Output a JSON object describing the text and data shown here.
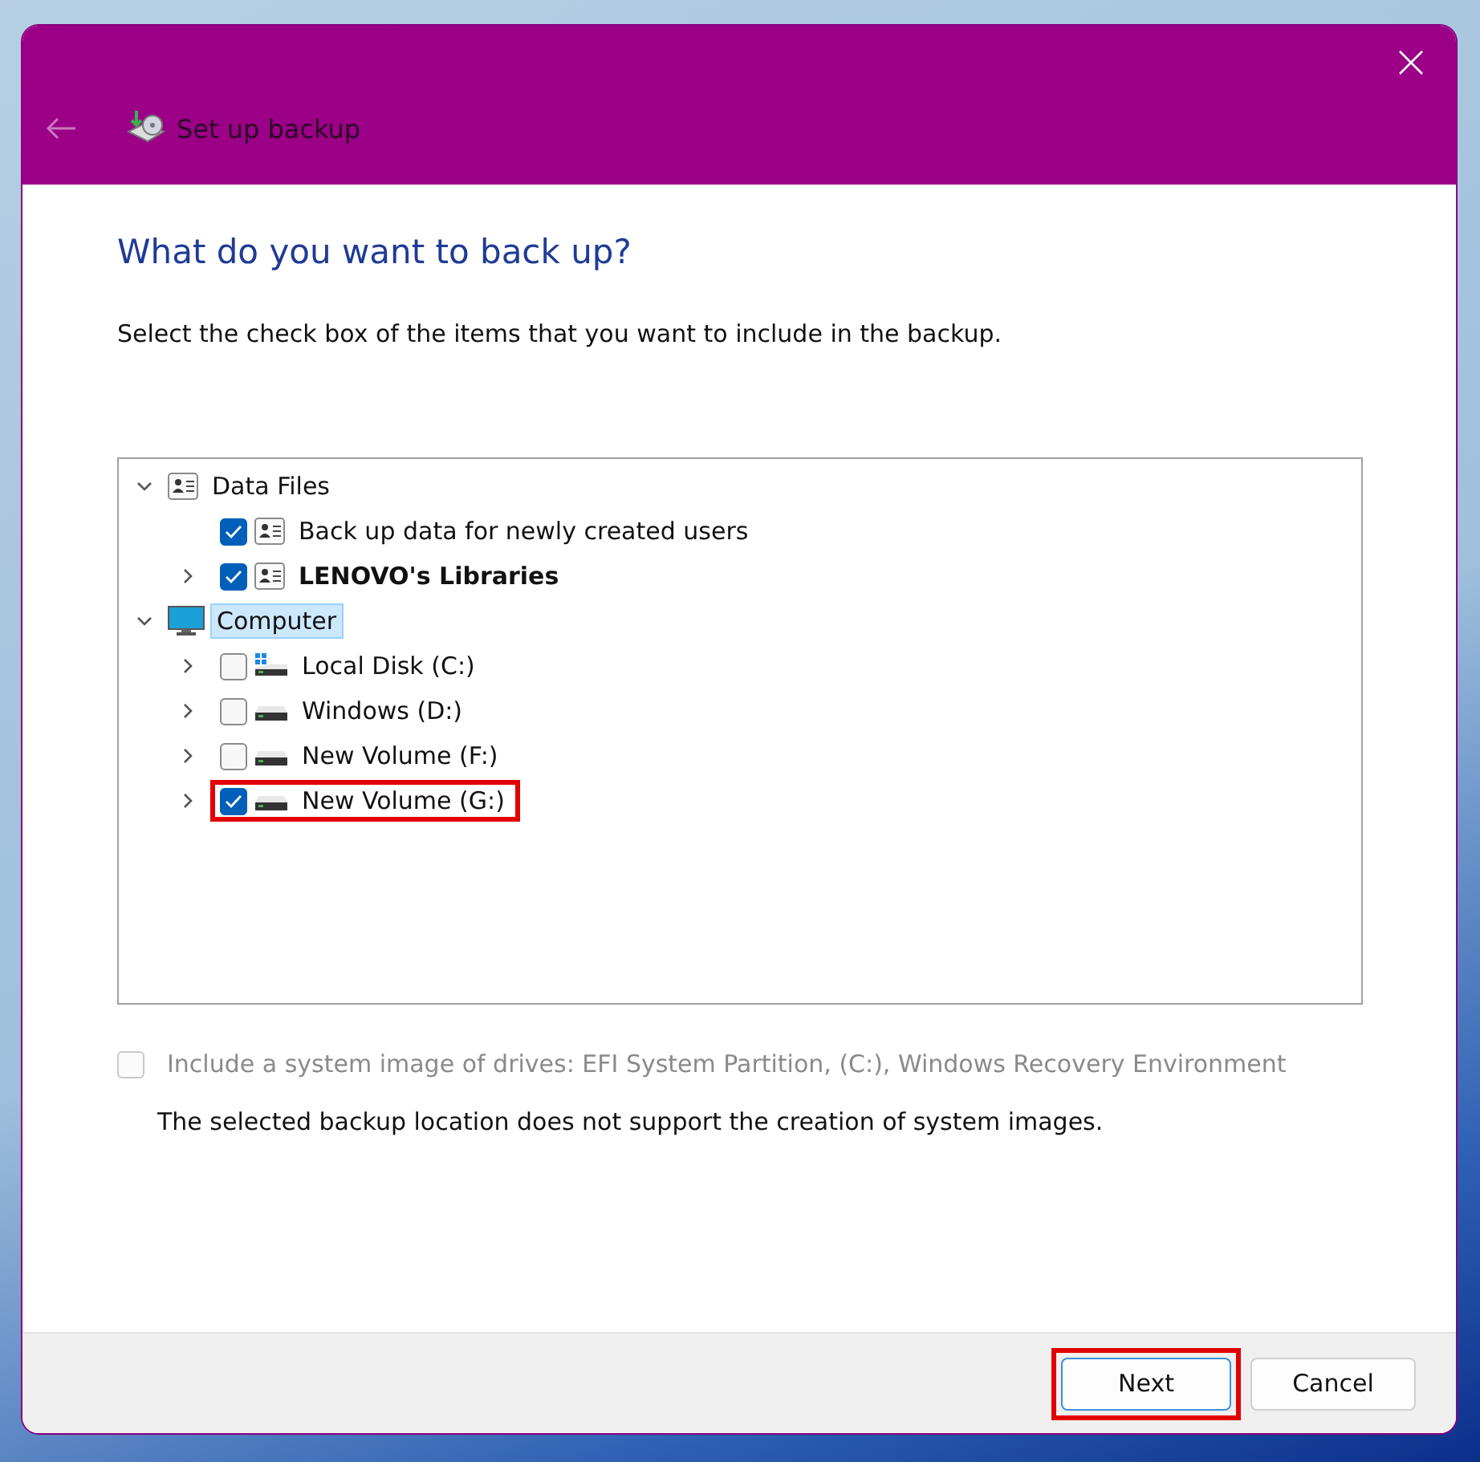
{
  "window": {
    "title": "Set up backup"
  },
  "heading": "What do you want to back up?",
  "instruction": "Select the check box of the items that you want to include in the backup.",
  "tree": [
    {
      "label": "Data Files",
      "kind": "user-list",
      "expanded": true,
      "selected": false,
      "children": [
        {
          "label": "Back up data for newly created users",
          "kind": "user-list",
          "checked": true,
          "bold": false,
          "highlighted": false
        },
        {
          "label": "LENOVO's Libraries",
          "kind": "user-list",
          "checked": true,
          "bold": true,
          "expanded": false,
          "highlighted": false
        }
      ]
    },
    {
      "label": "Computer",
      "kind": "monitor",
      "expanded": true,
      "selected": true,
      "children": [
        {
          "label": "Local Disk (C:)",
          "kind": "system-drive",
          "checked": false,
          "bold": false,
          "expanded": false,
          "highlighted": false
        },
        {
          "label": "Windows (D:)",
          "kind": "drive",
          "checked": false,
          "bold": false,
          "expanded": false,
          "highlighted": false
        },
        {
          "label": "New Volume (F:)",
          "kind": "drive",
          "checked": false,
          "bold": false,
          "expanded": false,
          "highlighted": false
        },
        {
          "label": "New Volume (G:)",
          "kind": "drive",
          "checked": true,
          "bold": false,
          "expanded": false,
          "highlighted": true
        }
      ]
    }
  ],
  "system_image": {
    "label": "Include a system image of drives: EFI System Partition, (C:), Windows Recovery Environment",
    "checked": false,
    "disabled": true
  },
  "note": "The selected backup location does not support the creation of system images.",
  "buttons": [
    {
      "label": "Next",
      "default": true,
      "highlighted": true
    },
    {
      "label": "Cancel",
      "default": false,
      "highlighted": false
    }
  ]
}
